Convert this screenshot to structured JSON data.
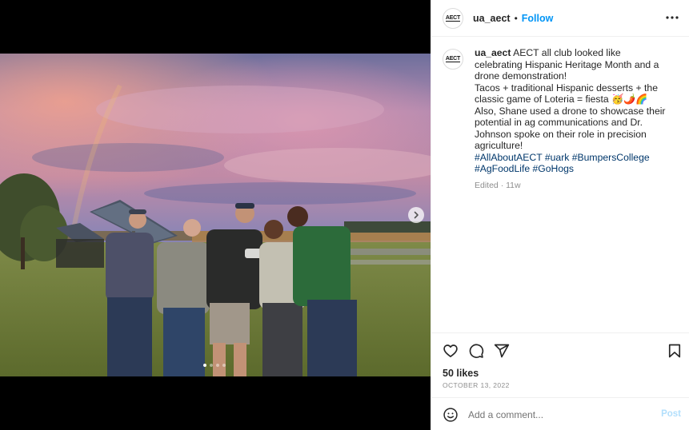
{
  "post": {
    "username": "ua_aect",
    "separator": "•",
    "follow_label": "Follow",
    "avatar_text": "AECT",
    "caption": {
      "username": "ua_aect",
      "text_lines": [
        "AECT all club looked like celebrating Hispanic Heritage Month and a drone demonstration!",
        "Tacos + traditional Hispanic desserts + the classic game of Loteria = fiesta 🥳🌶️🌈",
        "Also, Shane used a drone to showcase their potential in ag communications and Dr. Johnson spoke on their role in precision agriculture!"
      ],
      "hashtags": [
        "#AllAboutAECT",
        "#uark",
        "#BumpersCollege",
        "#AgFoodLife",
        "#GoHogs"
      ],
      "meta": "Edited · 11w"
    },
    "likes": "50 likes",
    "date": "OCTOBER 13, 2022"
  },
  "carousel": {
    "dot_count": 4,
    "active_index": 0
  },
  "comment": {
    "placeholder": "Add a comment...",
    "post_label": "Post"
  },
  "icons": {
    "more": "more-options-icon",
    "like": "heart-icon",
    "comment": "comment-icon",
    "share": "share-icon",
    "save": "bookmark-icon",
    "emoji": "emoji-icon",
    "next": "chevron-right-icon"
  },
  "colors": {
    "follow": "#0095f6",
    "hashtag": "#00376b",
    "post_disabled": "#b2dffc",
    "muted": "#8e8e8e"
  }
}
